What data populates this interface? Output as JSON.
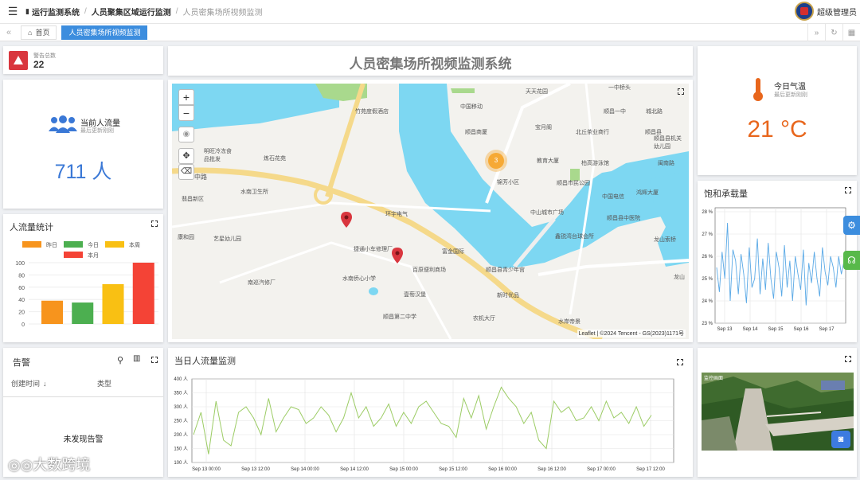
{
  "topbar": {
    "menu_icon": "hamburger-icon",
    "breadcrumbs": [
      "运行监测系统",
      "人员聚集区域运行监测",
      "人员密集场所视频监测"
    ],
    "user_name": "超级管理员"
  },
  "tabs": {
    "home": "首页",
    "active": "人员密集场所视频监测"
  },
  "alarm_total": {
    "label": "警告总数",
    "value": "22"
  },
  "page_title": "人员密集场所视频监测系统",
  "weather": {
    "title": "今日气温",
    "sub": "最后更新刚刚",
    "value": "21 °C"
  },
  "flow": {
    "title": "当前人流量",
    "sub": "最后更新刚刚",
    "value": "711 人"
  },
  "flow_stats": {
    "title": "人流量统计",
    "legend": [
      "昨日",
      "今日",
      "本周",
      "本月"
    ],
    "colors": [
      "#f7941d",
      "#4caf50",
      "#f9c013",
      "#f44336"
    ],
    "values": [
      38,
      35,
      65,
      100
    ],
    "yticks": [
      "100",
      "80",
      "60",
      "40",
      "20",
      "0"
    ]
  },
  "alarms": {
    "title": "告警",
    "col1": "创建时间",
    "col2": "类型",
    "empty": "未发现告警"
  },
  "daily_flow": {
    "title": "当日人流量监测",
    "yticks": [
      "400 人",
      "350 人",
      "300 人",
      "250 人",
      "200 人",
      "150 人",
      "100 人"
    ],
    "xticks": [
      "Sep 13 00:00",
      "Sep 13 12:00",
      "Sep 14 00:00",
      "Sep 14 12:00",
      "Sep 15 00:00",
      "Sep 15 12:00",
      "Sep 16 00:00",
      "Sep 16 12:00",
      "Sep 17 00:00",
      "Sep 17 12:00"
    ]
  },
  "saturation": {
    "title": "饱和承载量",
    "yticks": [
      "28 %",
      "27 %",
      "26 %",
      "25 %",
      "24 %",
      "23 %"
    ],
    "xticks": [
      "Sep 13",
      "Sep 14",
      "Sep 15",
      "Sep 16",
      "Sep 17"
    ]
  },
  "map": {
    "attribution": "Leaflet | ©2024 Tencent - GS(2023)1171号",
    "labels": [
      "一中桥头",
      "天天花园",
      "竹苑度假酒店",
      "中国移动",
      "顺昌一中",
      "城北路",
      "顺昌商厦",
      "宝月阁",
      "北丘茶业商行",
      "顺昌县",
      "顺昌县机关幼儿园",
      "明旺冷冻食品批发",
      "炼石花苑",
      "教育大厦",
      "柏高游泳馆",
      "闽南路",
      "锦芳小区",
      "顺昌市民公园",
      "中国电信",
      "鸿辉大厦",
      "中山城市广场",
      "顺昌县中医院",
      "水南卫生所",
      "鑫锐湾台球会所",
      "龙山索桥",
      "环宇电气",
      "捷通小车修理厂",
      "富金国际",
      "顺昌县青少年宫",
      "百原便利商场",
      "水南侨心小学",
      "新时优品",
      "壹萄汉堡",
      "顺昌第二中学",
      "农机大厅",
      "水岸帝景",
      "艺星幼儿园",
      "南巡汽修厂",
      "康和园",
      "翡昌新区",
      "中路",
      "龙山"
    ],
    "cluster": "3",
    "zoom_in": "+",
    "zoom_out": "−"
  },
  "video": {
    "overlay": "监控画面"
  },
  "watermark": "大数跨境"
}
